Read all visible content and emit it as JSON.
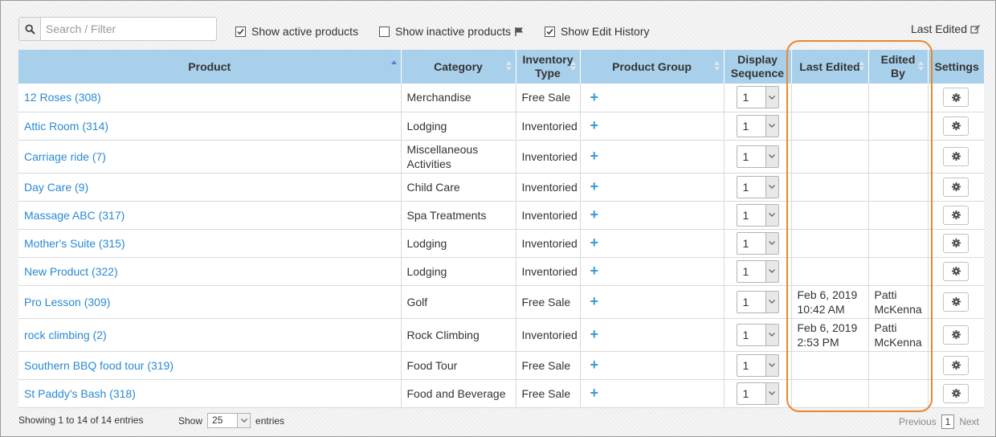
{
  "toolbar": {
    "search_placeholder": "Search / Filter",
    "show_active": "Show active products",
    "show_inactive": "Show inactive products",
    "show_history": "Show Edit History",
    "last_edited": "Last Edited"
  },
  "columns": {
    "product": "Product",
    "category": "Category",
    "inventory_1": "Inventory",
    "inventory_2": "Type",
    "group": "Product Group",
    "display_1": "Display",
    "display_2": "Sequence",
    "last_edited": "Last Edited",
    "edited_1": "Edited",
    "edited_2": "By",
    "settings": "Settings"
  },
  "rows": [
    {
      "product": "12 Roses (308)",
      "category": "Merchandise",
      "inventory": "Free Sale",
      "seq": "1",
      "edited_date": "",
      "edited_time": "",
      "edited_by_1": "",
      "edited_by_2": ""
    },
    {
      "product": "Attic Room (314)",
      "category": "Lodging",
      "inventory": "Inventoried",
      "seq": "1",
      "edited_date": "",
      "edited_time": "",
      "edited_by_1": "",
      "edited_by_2": ""
    },
    {
      "product": "Carriage ride (7)",
      "category": "Miscellaneous",
      "category_2": "Activities",
      "inventory": "Inventoried",
      "seq": "1",
      "edited_date": "",
      "edited_time": "",
      "edited_by_1": "",
      "edited_by_2": ""
    },
    {
      "product": "Day Care (9)",
      "category": "Child Care",
      "inventory": "Inventoried",
      "seq": "1",
      "edited_date": "",
      "edited_time": "",
      "edited_by_1": "",
      "edited_by_2": ""
    },
    {
      "product": "Massage ABC (317)",
      "category": "Spa Treatments",
      "inventory": "Inventoried",
      "seq": "1",
      "edited_date": "",
      "edited_time": "",
      "edited_by_1": "",
      "edited_by_2": ""
    },
    {
      "product": "Mother's Suite (315)",
      "category": "Lodging",
      "inventory": "Inventoried",
      "seq": "1",
      "edited_date": "",
      "edited_time": "",
      "edited_by_1": "",
      "edited_by_2": ""
    },
    {
      "product": "New Product (322)",
      "category": "Lodging",
      "inventory": "Inventoried",
      "seq": "1",
      "edited_date": "",
      "edited_time": "",
      "edited_by_1": "",
      "edited_by_2": ""
    },
    {
      "product": "Pro Lesson (309)",
      "category": "Golf",
      "inventory": "Free Sale",
      "seq": "1",
      "edited_date": "Feb 6, 2019",
      "edited_time": "10:42 AM",
      "edited_by_1": "Patti",
      "edited_by_2": "McKenna"
    },
    {
      "product": "rock climbing (2)",
      "category": "Rock Climbing",
      "inventory": "Inventoried",
      "seq": "1",
      "edited_date": "Feb 6, 2019",
      "edited_time": "2:53 PM",
      "edited_by_1": "Patti",
      "edited_by_2": "McKenna"
    },
    {
      "product": "Southern BBQ food tour (319)",
      "category": "Food Tour",
      "inventory": "Free Sale",
      "seq": "1",
      "edited_date": "",
      "edited_time": "",
      "edited_by_1": "",
      "edited_by_2": ""
    },
    {
      "product": "St Paddy's Bash (318)",
      "category": "Food and Beverage",
      "inventory": "Free Sale",
      "seq": "1",
      "edited_date": "",
      "edited_time": "",
      "edited_by_1": "",
      "edited_by_2": ""
    }
  ],
  "footer": {
    "info": "Showing 1 to 14 of 14 entries",
    "show": "Show",
    "length": "25",
    "entries": "entries",
    "previous": "Previous",
    "page": "1",
    "next": "Next"
  },
  "colors": {
    "header": "#a9d0ea",
    "link": "#2a8ad1",
    "highlight": "#e8882f"
  }
}
